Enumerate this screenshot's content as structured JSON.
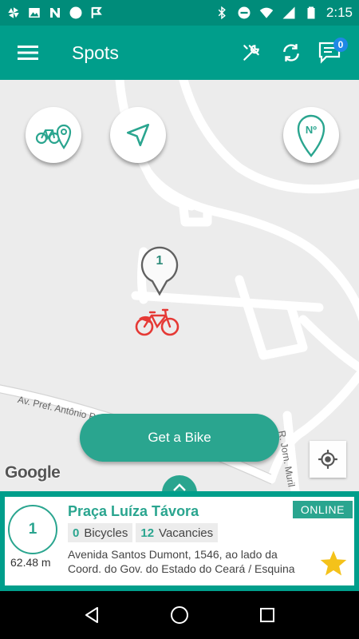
{
  "status_bar": {
    "time": "2:15",
    "left_icons": [
      "pinwheel-icon",
      "image-icon",
      "n-icon",
      "circle-icon",
      "check-flag-icon"
    ],
    "right_icons": [
      "bluetooth-icon",
      "do-not-disturb-icon",
      "wifi-icon",
      "signal-icon",
      "battery-icon"
    ]
  },
  "app_bar": {
    "title": "Spots",
    "menu_icon": "hamburger-menu-icon",
    "actions": [
      "tools-icon",
      "refresh-icon",
      "chat-icon"
    ],
    "chat_badge": "0"
  },
  "map": {
    "fabs": [
      "bike-location-icon",
      "navigate-icon",
      "number-pin-icon"
    ],
    "fab_number_pin_label": "Nº",
    "marker_label": "1",
    "street_labels": [
      "Av. Pref. Antônio Pereira",
      "R. Jorn. Muril"
    ],
    "get_bike_label": "Get a Bike",
    "google_label": "Google"
  },
  "station": {
    "number": "1",
    "distance": "62.48 m",
    "name": "Praça Luíza Távora",
    "status": "ONLINE",
    "bicycles_count": "0",
    "bicycles_label": "Bicycles",
    "vacancies_count": "12",
    "vacancies_label": "Vacancies",
    "address": "Avenida Santos Dumont, 1546, ao lado da Coord. do Gov. do Estado do Ceará / Esquina",
    "favorite": true
  },
  "colors": {
    "primary": "#009e8b",
    "primary_dark": "#008c7a",
    "accent": "#2aa58f",
    "bike_marker": "#e53935",
    "star": "#f4c21a"
  }
}
